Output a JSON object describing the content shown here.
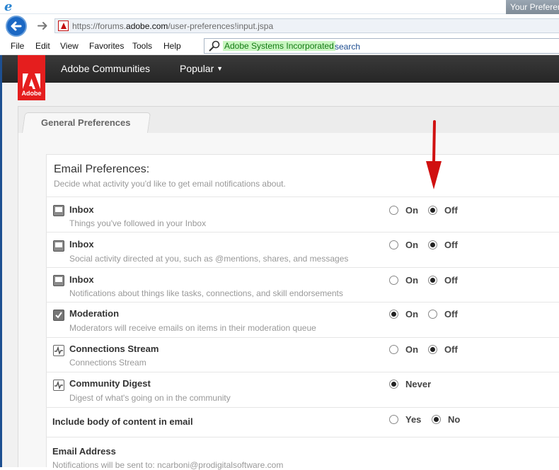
{
  "browser": {
    "tab_title": "Your Preferen",
    "url_prefix": "https://forums.",
    "url_domain": "adobe.com",
    "url_path": "/user-preferences!input.jspa",
    "menu": [
      "File",
      "Edit",
      "View",
      "Favorites",
      "Tools",
      "Help"
    ],
    "search_provider": "Adobe Systems Incorporated",
    "search_label": "search"
  },
  "site": {
    "logo_text": "Adobe",
    "nav": [
      "Adobe Communities",
      "Popular"
    ]
  },
  "tabs": {
    "active": "General Preferences"
  },
  "email_prefs": {
    "title": "Email Preferences:",
    "subtitle": "Decide what activity you'd like to get email notifications about.",
    "rows": [
      {
        "icon": "inbox-icon",
        "title": "Inbox",
        "desc": "Things you've followed in your Inbox",
        "on_label": "On",
        "off_label": "Off",
        "selected": "Off"
      },
      {
        "icon": "inbox-icon",
        "title": "Inbox",
        "desc": "Social activity directed at you, such as @mentions, shares, and messages",
        "on_label": "On",
        "off_label": "Off",
        "selected": "Off"
      },
      {
        "icon": "inbox-icon",
        "title": "Inbox",
        "desc": "Notifications about things like tasks, connections, and skill endorsements",
        "on_label": "On",
        "off_label": "Off",
        "selected": "Off"
      },
      {
        "icon": "checkbox-icon",
        "title": "Moderation",
        "desc": "Moderators will receive emails on items in their moderation queue",
        "on_label": "On",
        "off_label": "Off",
        "selected": "On"
      },
      {
        "icon": "activity-stream-icon",
        "title": "Connections Stream",
        "desc": "Connections Stream",
        "on_label": "On",
        "off_label": "Off",
        "selected": "Off"
      },
      {
        "icon": "activity-stream-icon",
        "title": "Community Digest",
        "desc": "Digest of what's going on in the community",
        "never_label": "Never",
        "selected": "Never"
      }
    ],
    "include_body": {
      "title": "Include body of content in email",
      "yes_label": "Yes",
      "no_label": "No",
      "selected": "No"
    },
    "email_address": {
      "title": "Email Address",
      "desc": "Notifications will be sent to: ncarboni@prodigitalsoftware.com"
    }
  },
  "colors": {
    "accent_red": "#e51e1e",
    "annotation_arrow": "#d01010",
    "header_bg": "#2f2f2f"
  }
}
